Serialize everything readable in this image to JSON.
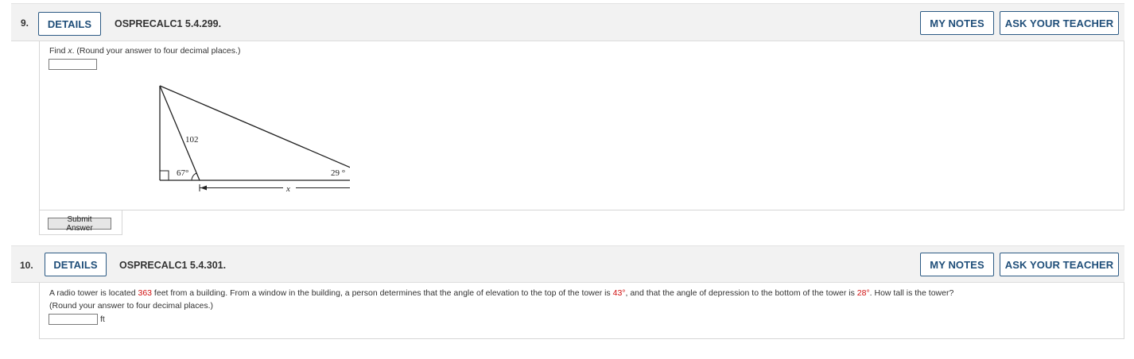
{
  "questions": [
    {
      "number": "9.",
      "details_label": "DETAILS",
      "code": "OSPRECALC1 5.4.299.",
      "my_notes_label": "MY NOTES",
      "ask_teacher_label": "ASK YOUR TEACHER",
      "prompt_start": "Find ",
      "prompt_var": "x",
      "prompt_end": ". (Round your answer to four decimal places.)",
      "answer_value": "",
      "figure": {
        "side_label": "102",
        "angle_left": "67°",
        "angle_right": "29 °",
        "base_label": "x"
      },
      "submit_label": "Submit Answer"
    },
    {
      "number": "10.",
      "details_label": "DETAILS",
      "code": "OSPRECALC1 5.4.301.",
      "my_notes_label": "MY NOTES",
      "ask_teacher_label": "ASK YOUR TEACHER",
      "prompt_part1": "A radio tower is located ",
      "distance": "363",
      "prompt_part2": " feet from a building. From a window in the building, a person determines that the angle of elevation to the top of the tower is ",
      "elevation_angle": "43°",
      "prompt_part3": ", and that the angle of depression to the bottom of the tower is ",
      "depression_angle": "28°",
      "prompt_part4": ". How tall is the tower?",
      "prompt_line2": "(Round your answer to four decimal places.)",
      "answer_value": "",
      "unit": "ft"
    }
  ],
  "colors": {
    "header_bg": "#f2f2f2",
    "button_border": "#2c5a84",
    "button_text": "#1f4e79",
    "highlight_red": "#d01010"
  }
}
